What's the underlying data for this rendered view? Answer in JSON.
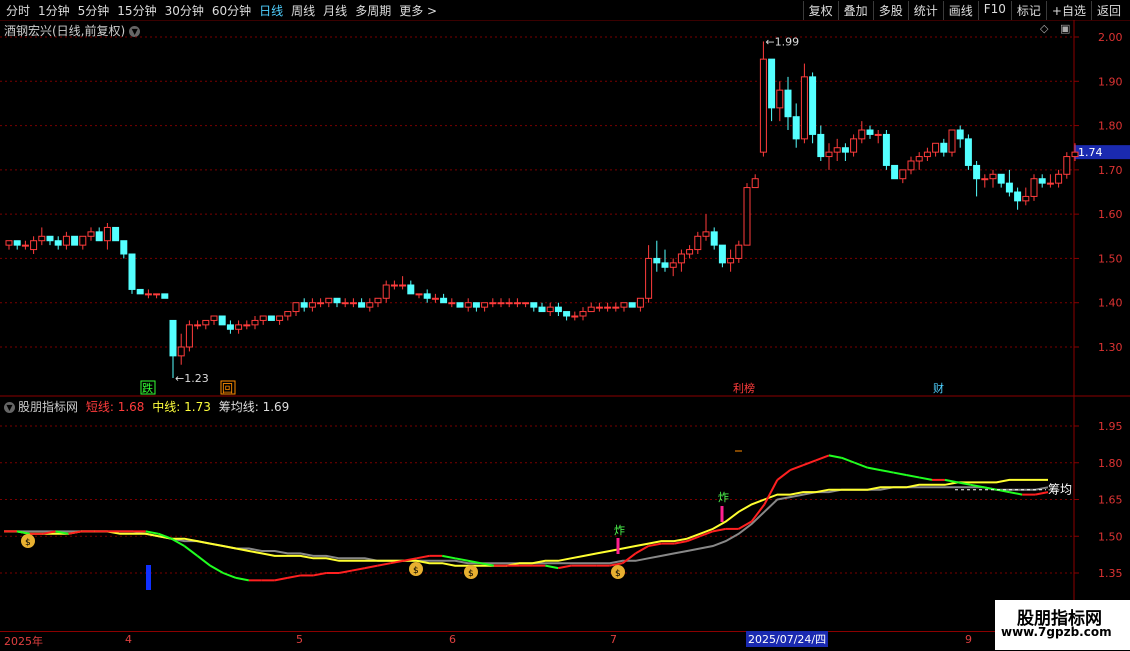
{
  "toolbar": {
    "periods": [
      "分时",
      "1分钟",
      "5分钟",
      "15分钟",
      "30分钟",
      "60分钟",
      "日线",
      "周线",
      "月线",
      "多周期",
      "更多 >"
    ],
    "actions": [
      "复权",
      "叠加",
      "多股",
      "统计",
      "画线",
      "F10",
      "标记",
      "+自选",
      "返回"
    ]
  },
  "main": {
    "title": "酒钢宏兴(日线,前复权)",
    "price_labels": [
      "2.00",
      "1.90",
      "1.80",
      "1.70",
      "1.60",
      "1.50",
      "1.40",
      "1.30"
    ],
    "current_price": "1.74",
    "high_label": "1.99",
    "low_label": "1.23",
    "markers": [
      "跌",
      "回",
      "利榜",
      "财"
    ]
  },
  "indicator": {
    "name": "股朋指标网",
    "short_label": "短线:",
    "short_value": "1.68",
    "mid_label": "中线:",
    "mid_value": "1.73",
    "chip_label": "筹均线:",
    "chip_value": "1.69",
    "axis_labels": [
      "1.95",
      "1.80",
      "1.65",
      "1.50",
      "1.35"
    ],
    "chip_tag": "筹均",
    "buy_tags": [
      "炸",
      "炸"
    ]
  },
  "dates": {
    "year": "2025年",
    "months": [
      "4",
      "5",
      "6",
      "7",
      "9"
    ],
    "selected": "2025/07/24/四"
  },
  "watermark": {
    "title": "股朋指标网",
    "url": "www.7gpzb.com"
  },
  "colors": {
    "up": "#ff3c3c",
    "down": "#54ffff",
    "grid": "#7a0000",
    "axis": "#8b0000"
  },
  "chart_data": {
    "type": "candlestick",
    "price_axis": [
      1.25,
      2.02
    ],
    "candles": [
      [
        1.53,
        1.54,
        1.52,
        1.54
      ],
      [
        1.54,
        1.54,
        1.52,
        1.53
      ],
      [
        1.53,
        1.54,
        1.52,
        1.53
      ],
      [
        1.52,
        1.55,
        1.51,
        1.54
      ],
      [
        1.54,
        1.57,
        1.53,
        1.55
      ],
      [
        1.55,
        1.55,
        1.53,
        1.54
      ],
      [
        1.54,
        1.55,
        1.52,
        1.53
      ],
      [
        1.53,
        1.56,
        1.52,
        1.55
      ],
      [
        1.55,
        1.55,
        1.53,
        1.53
      ],
      [
        1.53,
        1.55,
        1.52,
        1.55
      ],
      [
        1.55,
        1.57,
        1.54,
        1.56
      ],
      [
        1.56,
        1.57,
        1.54,
        1.54
      ],
      [
        1.54,
        1.58,
        1.52,
        1.57
      ],
      [
        1.57,
        1.57,
        1.54,
        1.54
      ],
      [
        1.54,
        1.54,
        1.5,
        1.51
      ],
      [
        1.51,
        1.51,
        1.42,
        1.43
      ],
      [
        1.43,
        1.43,
        1.42,
        1.42
      ],
      [
        1.42,
        1.43,
        1.41,
        1.42
      ],
      [
        1.42,
        1.42,
        1.41,
        1.42
      ],
      [
        1.42,
        1.42,
        1.41,
        1.41
      ],
      [
        1.36,
        1.36,
        1.23,
        1.28
      ],
      [
        1.28,
        1.33,
        1.26,
        1.3
      ],
      [
        1.3,
        1.36,
        1.29,
        1.35
      ],
      [
        1.35,
        1.36,
        1.34,
        1.35
      ],
      [
        1.35,
        1.36,
        1.34,
        1.36
      ],
      [
        1.36,
        1.37,
        1.35,
        1.37
      ],
      [
        1.37,
        1.37,
        1.35,
        1.35
      ],
      [
        1.35,
        1.36,
        1.33,
        1.34
      ],
      [
        1.34,
        1.36,
        1.33,
        1.35
      ],
      [
        1.35,
        1.36,
        1.34,
        1.35
      ],
      [
        1.35,
        1.37,
        1.34,
        1.36
      ],
      [
        1.36,
        1.37,
        1.35,
        1.37
      ],
      [
        1.37,
        1.37,
        1.36,
        1.36
      ],
      [
        1.36,
        1.37,
        1.35,
        1.37
      ],
      [
        1.37,
        1.38,
        1.36,
        1.38
      ],
      [
        1.38,
        1.4,
        1.37,
        1.4
      ],
      [
        1.4,
        1.41,
        1.38,
        1.39
      ],
      [
        1.39,
        1.41,
        1.38,
        1.4
      ],
      [
        1.4,
        1.41,
        1.39,
        1.4
      ],
      [
        1.4,
        1.41,
        1.39,
        1.41
      ],
      [
        1.41,
        1.41,
        1.39,
        1.4
      ],
      [
        1.4,
        1.41,
        1.39,
        1.4
      ],
      [
        1.4,
        1.41,
        1.39,
        1.4
      ],
      [
        1.4,
        1.41,
        1.39,
        1.39
      ],
      [
        1.39,
        1.41,
        1.38,
        1.4
      ],
      [
        1.4,
        1.41,
        1.39,
        1.41
      ],
      [
        1.41,
        1.45,
        1.4,
        1.44
      ],
      [
        1.44,
        1.45,
        1.43,
        1.44
      ],
      [
        1.44,
        1.46,
        1.43,
        1.44
      ],
      [
        1.44,
        1.45,
        1.42,
        1.42
      ],
      [
        1.42,
        1.42,
        1.41,
        1.42
      ],
      [
        1.42,
        1.43,
        1.4,
        1.41
      ],
      [
        1.41,
        1.42,
        1.4,
        1.41
      ],
      [
        1.41,
        1.42,
        1.4,
        1.4
      ],
      [
        1.4,
        1.41,
        1.39,
        1.4
      ],
      [
        1.4,
        1.4,
        1.39,
        1.39
      ],
      [
        1.39,
        1.41,
        1.38,
        1.4
      ],
      [
        1.4,
        1.4,
        1.38,
        1.39
      ],
      [
        1.39,
        1.4,
        1.38,
        1.4
      ],
      [
        1.4,
        1.41,
        1.39,
        1.4
      ],
      [
        1.4,
        1.41,
        1.39,
        1.4
      ],
      [
        1.4,
        1.41,
        1.39,
        1.4
      ],
      [
        1.4,
        1.41,
        1.39,
        1.4
      ],
      [
        1.4,
        1.4,
        1.39,
        1.4
      ],
      [
        1.4,
        1.4,
        1.38,
        1.39
      ],
      [
        1.39,
        1.4,
        1.38,
        1.38
      ],
      [
        1.38,
        1.4,
        1.37,
        1.39
      ],
      [
        1.39,
        1.4,
        1.37,
        1.38
      ],
      [
        1.38,
        1.38,
        1.36,
        1.37
      ],
      [
        1.37,
        1.38,
        1.36,
        1.37
      ],
      [
        1.37,
        1.39,
        1.36,
        1.38
      ],
      [
        1.38,
        1.4,
        1.38,
        1.39
      ],
      [
        1.39,
        1.4,
        1.38,
        1.39
      ],
      [
        1.39,
        1.4,
        1.38,
        1.39
      ],
      [
        1.39,
        1.4,
        1.38,
        1.39
      ],
      [
        1.39,
        1.4,
        1.38,
        1.4
      ],
      [
        1.4,
        1.4,
        1.39,
        1.39
      ],
      [
        1.39,
        1.41,
        1.38,
        1.41
      ],
      [
        1.41,
        1.53,
        1.4,
        1.5
      ],
      [
        1.5,
        1.54,
        1.47,
        1.49
      ],
      [
        1.49,
        1.52,
        1.47,
        1.48
      ],
      [
        1.48,
        1.5,
        1.46,
        1.49
      ],
      [
        1.49,
        1.52,
        1.47,
        1.51
      ],
      [
        1.51,
        1.53,
        1.5,
        1.52
      ],
      [
        1.52,
        1.56,
        1.51,
        1.55
      ],
      [
        1.55,
        1.6,
        1.54,
        1.56
      ],
      [
        1.56,
        1.57,
        1.52,
        1.53
      ],
      [
        1.53,
        1.53,
        1.48,
        1.49
      ],
      [
        1.49,
        1.52,
        1.47,
        1.5
      ],
      [
        1.5,
        1.54,
        1.49,
        1.53
      ],
      [
        1.53,
        1.67,
        1.53,
        1.66
      ],
      [
        1.66,
        1.69,
        1.66,
        1.68
      ],
      [
        1.74,
        1.99,
        1.73,
        1.95
      ],
      [
        1.95,
        1.95,
        1.81,
        1.84
      ],
      [
        1.84,
        1.9,
        1.81,
        1.88
      ],
      [
        1.88,
        1.91,
        1.79,
        1.82
      ],
      [
        1.82,
        1.85,
        1.75,
        1.77
      ],
      [
        1.77,
        1.94,
        1.76,
        1.91
      ],
      [
        1.91,
        1.92,
        1.76,
        1.78
      ],
      [
        1.78,
        1.8,
        1.72,
        1.73
      ],
      [
        1.73,
        1.76,
        1.7,
        1.74
      ],
      [
        1.74,
        1.77,
        1.72,
        1.75
      ],
      [
        1.75,
        1.76,
        1.72,
        1.74
      ],
      [
        1.74,
        1.78,
        1.73,
        1.77
      ],
      [
        1.77,
        1.81,
        1.76,
        1.79
      ],
      [
        1.79,
        1.8,
        1.77,
        1.78
      ],
      [
        1.78,
        1.79,
        1.76,
        1.78
      ],
      [
        1.78,
        1.79,
        1.7,
        1.71
      ],
      [
        1.71,
        1.71,
        1.68,
        1.68
      ],
      [
        1.68,
        1.7,
        1.67,
        1.7
      ],
      [
        1.7,
        1.73,
        1.69,
        1.72
      ],
      [
        1.72,
        1.74,
        1.7,
        1.73
      ],
      [
        1.73,
        1.75,
        1.72,
        1.74
      ],
      [
        1.74,
        1.76,
        1.73,
        1.76
      ],
      [
        1.76,
        1.77,
        1.73,
        1.74
      ],
      [
        1.74,
        1.79,
        1.73,
        1.79
      ],
      [
        1.79,
        1.8,
        1.75,
        1.77
      ],
      [
        1.77,
        1.78,
        1.7,
        1.71
      ],
      [
        1.71,
        1.72,
        1.64,
        1.68
      ],
      [
        1.68,
        1.69,
        1.66,
        1.68
      ],
      [
        1.68,
        1.7,
        1.66,
        1.69
      ],
      [
        1.69,
        1.69,
        1.66,
        1.67
      ],
      [
        1.67,
        1.7,
        1.64,
        1.65
      ],
      [
        1.65,
        1.66,
        1.61,
        1.63
      ],
      [
        1.63,
        1.66,
        1.62,
        1.64
      ],
      [
        1.64,
        1.69,
        1.63,
        1.68
      ],
      [
        1.68,
        1.69,
        1.66,
        1.67
      ],
      [
        1.67,
        1.69,
        1.66,
        1.67
      ],
      [
        1.67,
        1.7,
        1.66,
        1.69
      ],
      [
        1.69,
        1.74,
        1.68,
        1.73
      ],
      [
        1.73,
        1.76,
        1.72,
        1.74
      ]
    ],
    "short_line": [
      1.52,
      1.52,
      1.51,
      1.51,
      1.52,
      1.51,
      1.52,
      1.52,
      1.52,
      1.52,
      1.52,
      1.52,
      1.51,
      1.49,
      1.46,
      1.42,
      1.38,
      1.35,
      1.33,
      1.32,
      1.32,
      1.32,
      1.33,
      1.34,
      1.34,
      1.35,
      1.35,
      1.36,
      1.37,
      1.38,
      1.39,
      1.4,
      1.41,
      1.42,
      1.42,
      1.41,
      1.4,
      1.39,
      1.38,
      1.38,
      1.38,
      1.38,
      1.38,
      1.37,
      1.38,
      1.38,
      1.38,
      1.38,
      1.39,
      1.43,
      1.46,
      1.47,
      1.47,
      1.48,
      1.5,
      1.52,
      1.53,
      1.53,
      1.56,
      1.63,
      1.73,
      1.77,
      1.79,
      1.81,
      1.83,
      1.82,
      1.8,
      1.78,
      1.77,
      1.76,
      1.75,
      1.74,
      1.73,
      1.73,
      1.72,
      1.71,
      1.7,
      1.69,
      1.68,
      1.67,
      1.67,
      1.68
    ],
    "mid_line": [
      1.52,
      1.52,
      1.51,
      1.51,
      1.51,
      1.51,
      1.52,
      1.52,
      1.52,
      1.51,
      1.51,
      1.51,
      1.5,
      1.49,
      1.49,
      1.48,
      1.47,
      1.46,
      1.45,
      1.44,
      1.43,
      1.42,
      1.42,
      1.42,
      1.41,
      1.41,
      1.4,
      1.4,
      1.4,
      1.4,
      1.4,
      1.4,
      1.4,
      1.39,
      1.39,
      1.38,
      1.38,
      1.38,
      1.38,
      1.38,
      1.39,
      1.39,
      1.4,
      1.4,
      1.41,
      1.42,
      1.43,
      1.44,
      1.45,
      1.46,
      1.47,
      1.48,
      1.48,
      1.49,
      1.51,
      1.53,
      1.56,
      1.6,
      1.63,
      1.65,
      1.67,
      1.67,
      1.68,
      1.68,
      1.69,
      1.69,
      1.69,
      1.69,
      1.7,
      1.7,
      1.7,
      1.71,
      1.71,
      1.71,
      1.72,
      1.72,
      1.72,
      1.72,
      1.73,
      1.73,
      1.73,
      1.73
    ],
    "chip_line": [
      1.52,
      1.52,
      1.52,
      1.52,
      1.52,
      1.52,
      1.52,
      1.52,
      1.52,
      1.52,
      1.52,
      1.51,
      1.5,
      1.49,
      1.48,
      1.48,
      1.47,
      1.46,
      1.45,
      1.45,
      1.44,
      1.44,
      1.43,
      1.43,
      1.42,
      1.42,
      1.41,
      1.41,
      1.41,
      1.4,
      1.4,
      1.4,
      1.4,
      1.4,
      1.4,
      1.4,
      1.39,
      1.39,
      1.39,
      1.39,
      1.39,
      1.39,
      1.39,
      1.39,
      1.39,
      1.39,
      1.39,
      1.39,
      1.4,
      1.4,
      1.41,
      1.42,
      1.43,
      1.44,
      1.45,
      1.46,
      1.48,
      1.51,
      1.55,
      1.6,
      1.65,
      1.66,
      1.67,
      1.68,
      1.68,
      1.69,
      1.69,
      1.69,
      1.69,
      1.7,
      1.7,
      1.7,
      1.7,
      1.7,
      1.7,
      1.7,
      1.7,
      1.69,
      1.69,
      1.69,
      1.69,
      1.7
    ],
    "ind_axis": [
      1.28,
      2.02
    ]
  }
}
